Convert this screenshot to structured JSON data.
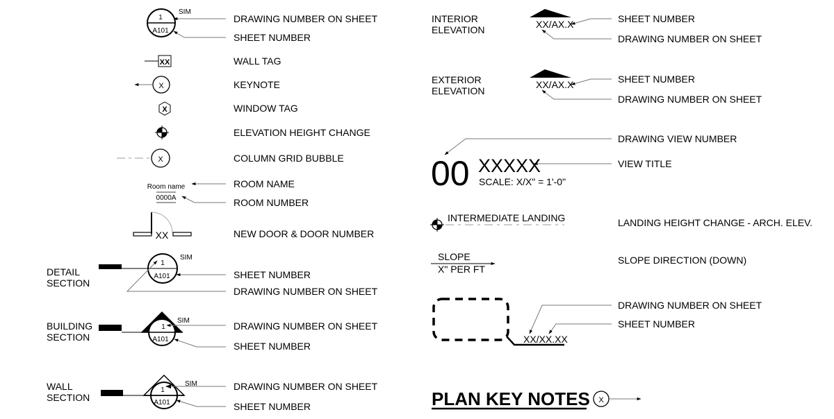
{
  "left_column": {
    "section_marker": {
      "top_value": "1",
      "bottom_value": "A101",
      "sim": "SIM",
      "labels": [
        "DRAWING NUMBER ON SHEET",
        "SHEET NUMBER"
      ]
    },
    "wall_tag": {
      "symbol_text": "XX",
      "label": "WALL TAG"
    },
    "keynote": {
      "symbol_text": "X",
      "label": "KEYNOTE"
    },
    "window_tag": {
      "symbol_text": "X",
      "label": "WINDOW TAG"
    },
    "elevation_height_change": {
      "label": "ELEVATION HEIGHT CHANGE"
    },
    "column_grid_bubble": {
      "symbol_text": "X",
      "label": "COLUMN GRID BUBBLE"
    },
    "room_tag": {
      "name_text": "Room name",
      "number_text": "0000A",
      "labels": [
        "ROOM NAME",
        "ROOM NUMBER"
      ]
    },
    "new_door": {
      "symbol_text": "XX",
      "label": "NEW DOOR & DOOR NUMBER"
    },
    "detail_section": {
      "title": [
        "DETAIL",
        "SECTION"
      ],
      "top_value": "1",
      "bottom_value": "A101",
      "sim": "SIM",
      "labels": [
        "SHEET NUMBER",
        "DRAWING NUMBER ON SHEET"
      ]
    },
    "building_section": {
      "title": [
        "BUILDING",
        "SECTION"
      ],
      "top_value": "1",
      "bottom_value": "A101",
      "sim": "SIM",
      "labels": [
        "DRAWING NUMBER ON SHEET",
        "SHEET NUMBER"
      ]
    },
    "wall_section": {
      "title": [
        "WALL",
        "SECTION"
      ],
      "top_value": "1",
      "bottom_value": "A101",
      "sim": "SIM",
      "labels": [
        "DRAWING NUMBER ON SHEET",
        "SHEET NUMBER"
      ]
    }
  },
  "right_column": {
    "interior_elevation": {
      "title": [
        "INTERIOR",
        "ELEVATION"
      ],
      "symbol_text": "XX/AX.X",
      "labels": [
        "SHEET NUMBER",
        "DRAWING NUMBER ON SHEET"
      ]
    },
    "exterior_elevation": {
      "title": [
        "EXTERIOR",
        "ELEVATION"
      ],
      "symbol_text": "XX/AX.X",
      "labels": [
        "SHEET NUMBER",
        "DRAWING NUMBER ON SHEET"
      ]
    },
    "view_title": {
      "view_number": "00",
      "title_text": "XXXXX",
      "scale_text": "SCALE: X/X\" = 1'-0\"",
      "labels": [
        "DRAWING VIEW NUMBER",
        "VIEW TITLE"
      ]
    },
    "landing": {
      "symbol_text": "INTERMEDIATE LANDING",
      "label": "LANDING HEIGHT CHANGE - ARCH. ELEV."
    },
    "slope": {
      "top_text": "SLOPE",
      "bottom_text": "X\" PER FT",
      "label": "SLOPE DIRECTION (DOWN)"
    },
    "enlarged_plan": {
      "symbol_text": "XX/XX.XX",
      "labels": [
        "DRAWING NUMBER ON SHEET",
        "SHEET NUMBER"
      ]
    },
    "plan_key_notes": {
      "title": "PLAN KEY NOTES",
      "symbol_text": "X"
    }
  }
}
